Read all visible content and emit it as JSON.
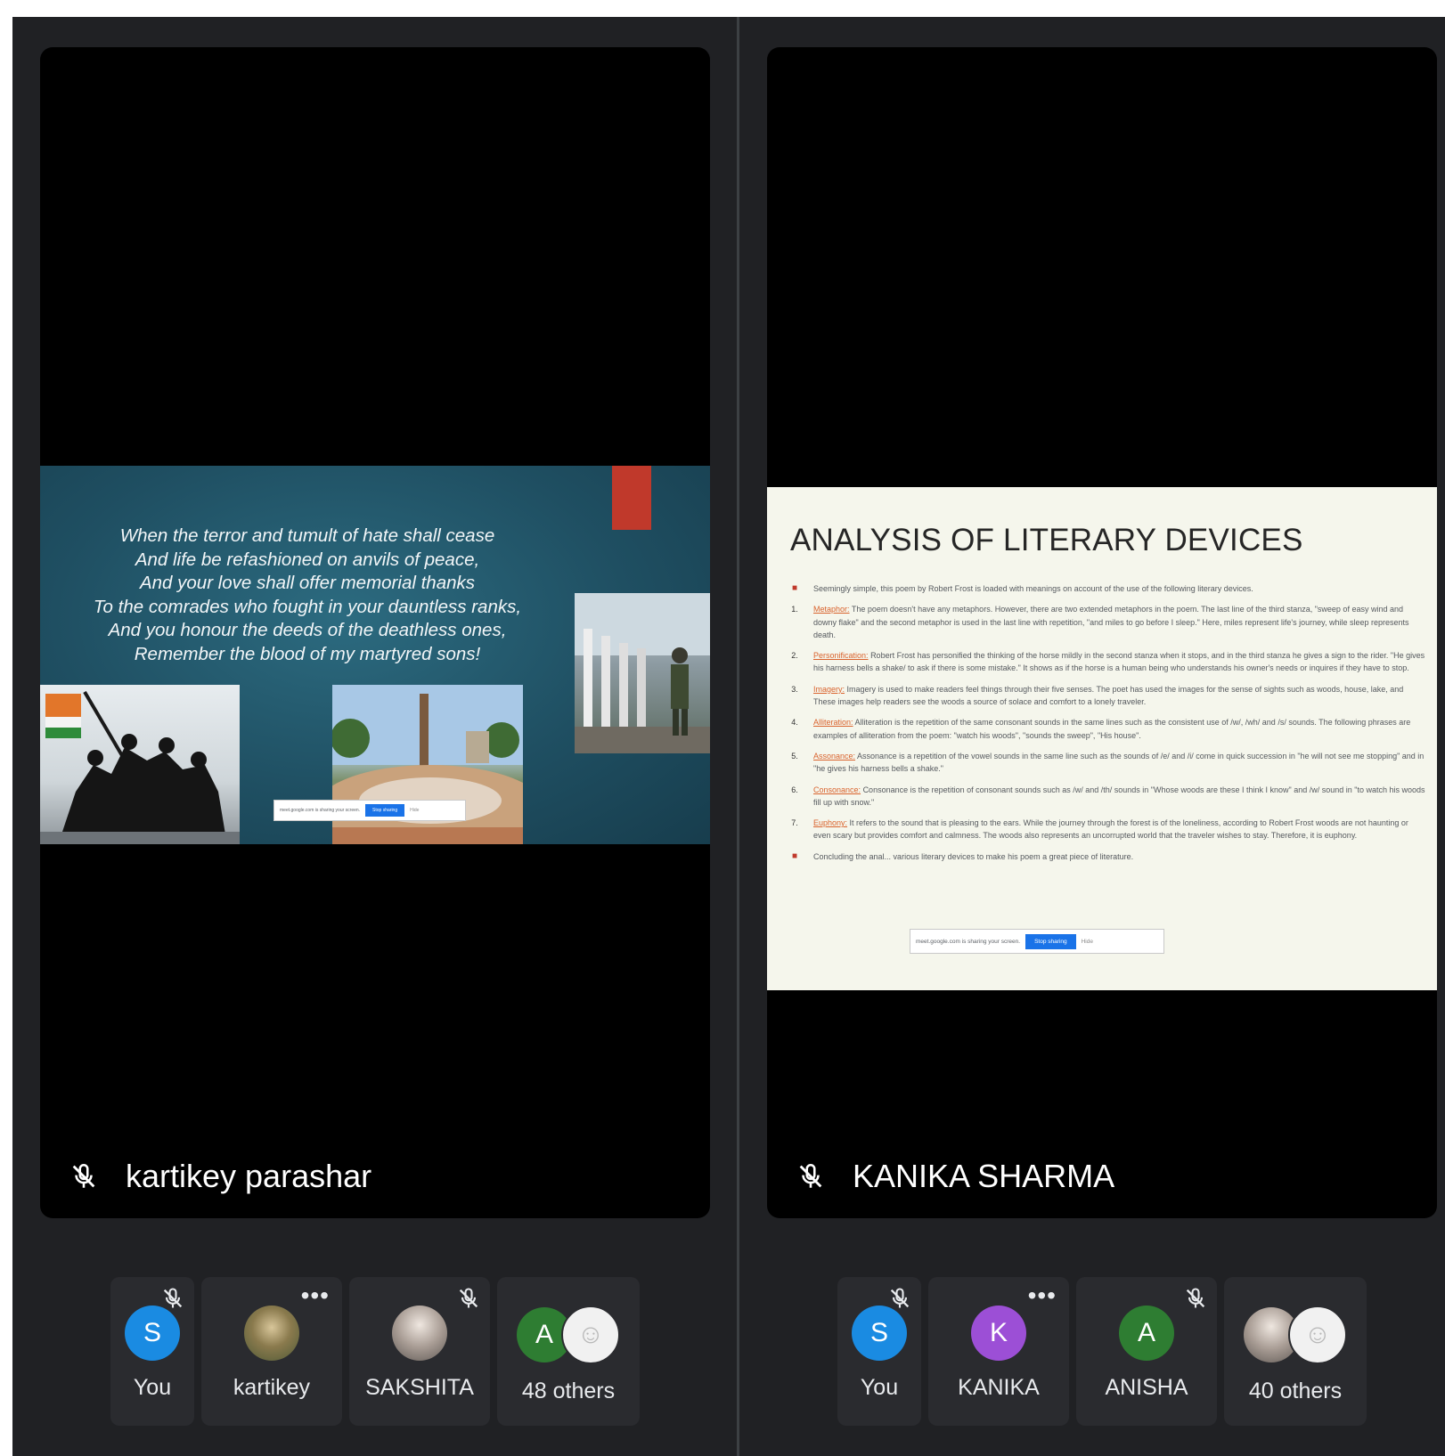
{
  "left": {
    "presenter_name": "kartikey parashar",
    "slide": {
      "poem": [
        "When the terror and tumult of hate shall cease",
        "And life be refashioned on anvils of peace,",
        "And your love shall offer memorial thanks",
        "To the comrades who fought in your dauntless ranks,",
        "And you honour the deeds of the deathless ones,",
        "Remember the blood of my martyred sons!"
      ],
      "share_bar": {
        "text": "meet.google.com is sharing your screen.",
        "stop": "Stop sharing",
        "hide": "Hide"
      }
    },
    "participants": [
      {
        "label": "You",
        "initial": "S",
        "color": "#1a8be2",
        "indicator": "mic-off"
      },
      {
        "label": "kartikey",
        "initial": "",
        "color": "",
        "indicator": "more"
      },
      {
        "label": "SAKSHITA",
        "initial": "",
        "color": "",
        "indicator": "mic-off"
      },
      {
        "label": "48 others",
        "initial": "A",
        "color": "#2e7d32",
        "indicator": ""
      }
    ]
  },
  "right": {
    "presenter_name": "KANIKA SHARMA",
    "slide": {
      "title": "ANALYSIS OF LITERARY DEVICES",
      "items": [
        {
          "marker": "■",
          "label": "",
          "text": "Seemingly simple, this poem by Robert Frost is loaded with meanings on account of the use of the following literary devices."
        },
        {
          "marker": "1.",
          "label": "Metaphor:",
          "text": "The poem doesn't have any metaphors. However, there are two extended metaphors in the poem. The last line of the third stanza, \"sweep of easy wind and downy flake\" and the second metaphor is used in the last line with repetition, \"and miles to go before I sleep.\" Here, miles represent life's journey, while sleep represents death."
        },
        {
          "marker": "2.",
          "label": "Personification:",
          "text": "Robert Frost has personified the thinking of the horse mildly in the second stanza when it stops, and in the third stanza he gives a sign to the rider. \"He gives his harness bells a shake/ to ask if there is some mistake.\" It shows as if the horse is a human being who understands his owner's needs or inquires if they have to stop."
        },
        {
          "marker": "3.",
          "label": "Imagery:",
          "text": "Imagery is used to make readers feel things through their five senses. The poet has used the images for the sense of sights such as woods, house, lake, and These images help readers see the woods a source of solace and comfort to a lonely traveler."
        },
        {
          "marker": "4.",
          "label": "Alliteration:",
          "text": "Alliteration is the repetition of the same consonant sounds in the same lines such as the consistent use of /w/, /wh/ and /s/ sounds. The following phrases are examples of alliteration from the poem: \"watch his woods\", \"sounds the sweep\", \"His house\"."
        },
        {
          "marker": "5.",
          "label": "Assonance:",
          "text": "Assonance is a repetition of the vowel sounds in the same line such as the sounds of /e/ and /i/ come in quick succession in \"he will not see me stopping\" and in \"he gives his harness bells a shake.\""
        },
        {
          "marker": "6.",
          "label": "Consonance:",
          "text": "Consonance is the repetition of consonant sounds such as /w/ and /th/ sounds in \"Whose woods are these I think I know\" and /w/ sound in \"to watch his woods fill up with snow.\""
        },
        {
          "marker": "7.",
          "label": "Euphony:",
          "text": "It refers to the sound that is pleasing to the ears. While the journey through the forest is of the loneliness, according to Robert Frost woods are not haunting or even scary but provides comfort and calmness. The woods also represents an uncorrupted world that the traveler wishes to stay. Therefore, it is euphony."
        },
        {
          "marker": "■",
          "label": "",
          "text": "Concluding the anal... various literary devices to make his poem a great piece of literature."
        }
      ],
      "share_bar": {
        "text": "meet.google.com is sharing your screen.",
        "stop": "Stop sharing",
        "hide": "Hide"
      }
    },
    "participants": [
      {
        "label": "You",
        "initial": "S",
        "color": "#1a8be2",
        "indicator": "mic-off"
      },
      {
        "label": "KANIKA",
        "initial": "K",
        "color": "#9c4fd6",
        "indicator": "more"
      },
      {
        "label": "ANISHA",
        "initial": "A",
        "color": "#2e7d32",
        "indicator": "mic-off"
      },
      {
        "label": "40 others",
        "initial": "",
        "color": "",
        "indicator": ""
      }
    ]
  }
}
